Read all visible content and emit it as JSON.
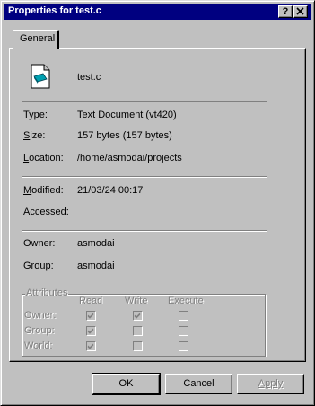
{
  "window": {
    "title": "Properties for test.c",
    "help_button": "?",
    "close_button": "X"
  },
  "tabs": [
    {
      "label": "General"
    }
  ],
  "file": {
    "name": "test.c",
    "icon": "text-document-icon"
  },
  "info": {
    "type_label": "Type:",
    "type_value": "Text Document (vt420)",
    "size_label": "Size:",
    "size_value": "157 bytes (157 bytes)",
    "location_label": "Location:",
    "location_value": "/home/asmodai/projects",
    "modified_label": "Modified:",
    "modified_value": "21/03/24 00:17",
    "accessed_label": "Accessed:",
    "accessed_value": "",
    "owner_label": "Owner:",
    "owner_value": "asmodai",
    "group_label": "Group:",
    "group_value": "asmodai"
  },
  "attributes": {
    "title": "Attributes",
    "columns": [
      "Read",
      "Write",
      "Execute"
    ],
    "rows": [
      {
        "label": "Owner:",
        "values": [
          true,
          true,
          false
        ]
      },
      {
        "label": "Group:",
        "values": [
          true,
          false,
          false
        ]
      },
      {
        "label": "World:",
        "values": [
          true,
          false,
          false
        ]
      }
    ]
  },
  "buttons": {
    "ok": "OK",
    "cancel": "Cancel",
    "apply": "Apply"
  }
}
